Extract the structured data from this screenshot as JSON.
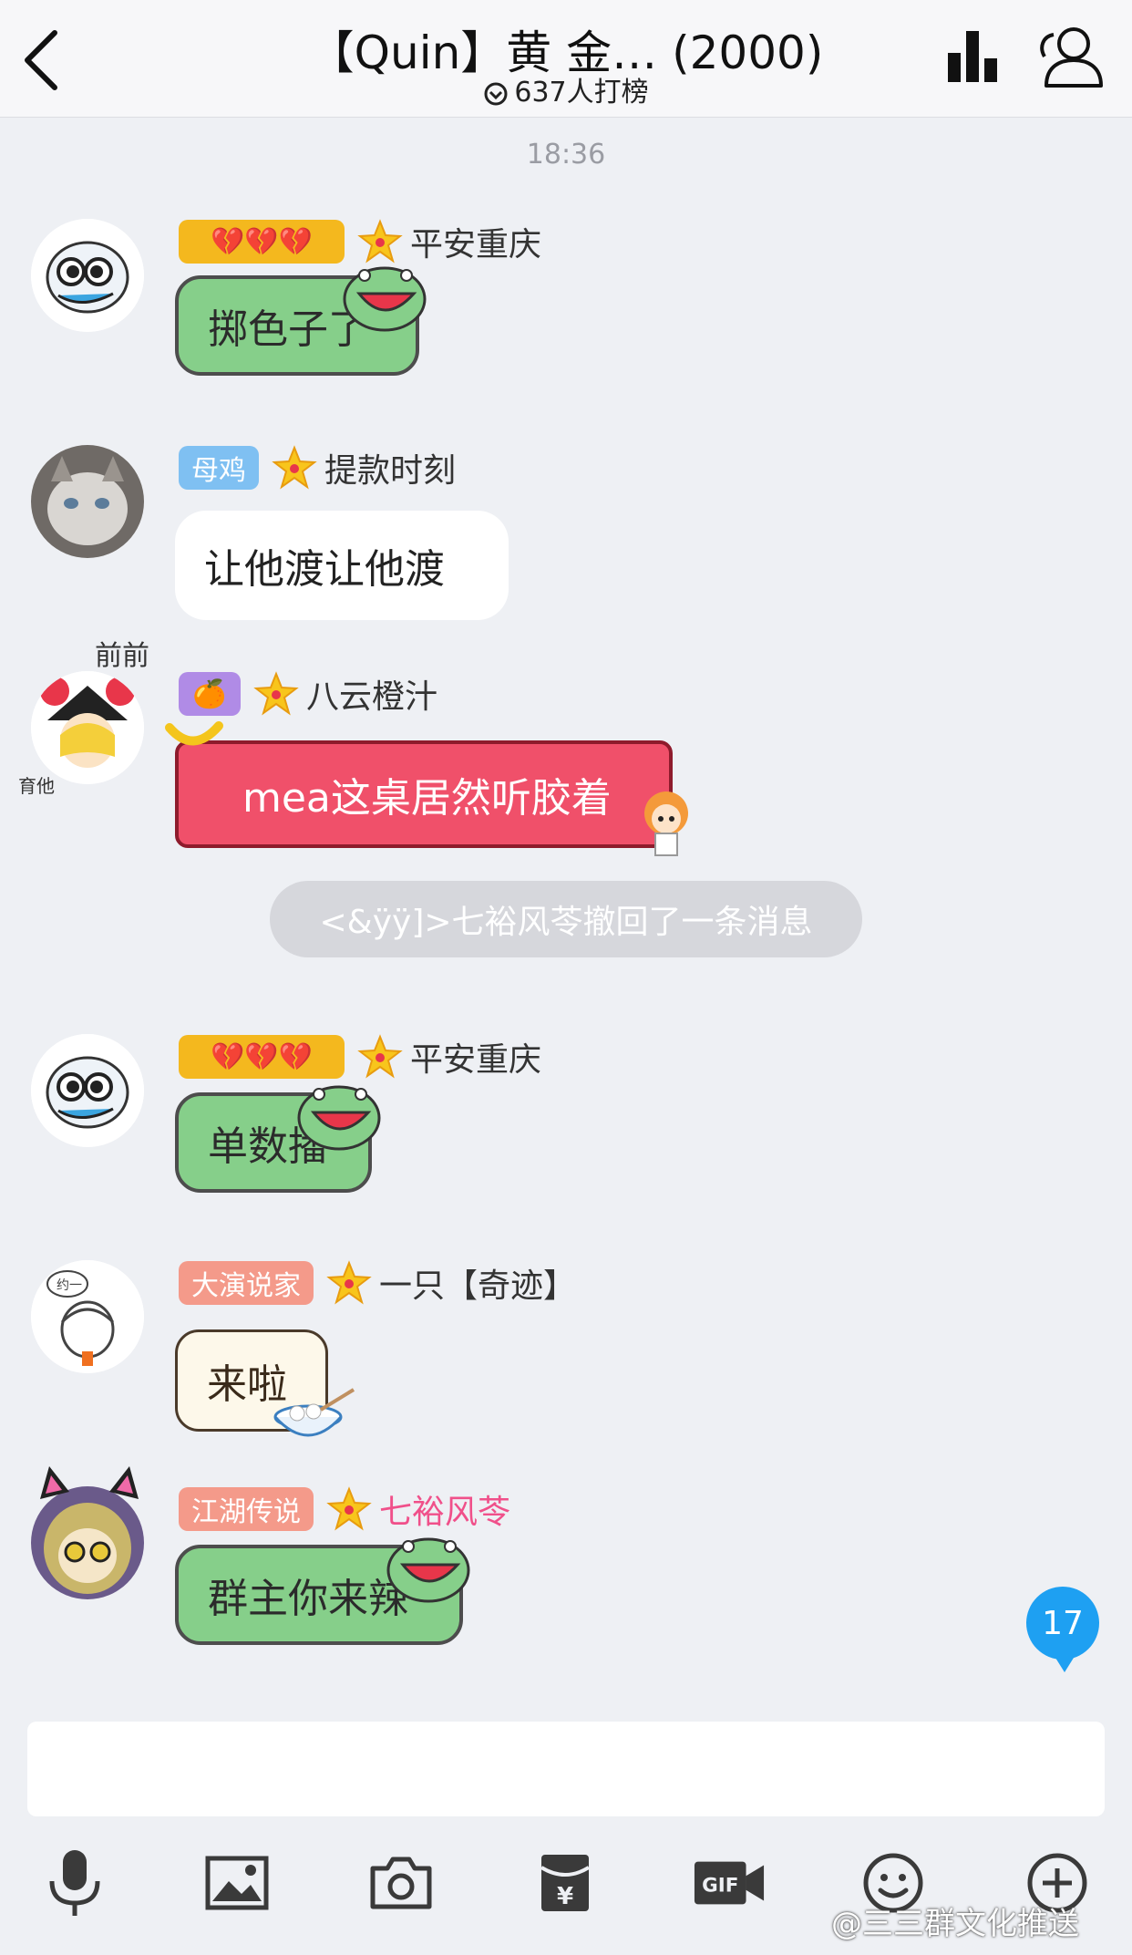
{
  "header": {
    "title": "【Quin】黄 金… (2000)",
    "subtitle": "637人打榜"
  },
  "timestamp": "18:36",
  "messages": [
    {
      "badge": "💔💔💔",
      "sender": "平安重庆",
      "text": "掷色子了"
    },
    {
      "badge": "母鸡",
      "sender": "提款时刻",
      "text": "让他渡让他渡"
    },
    {
      "badge": "🍊",
      "sender": "八云橙汁",
      "text": "mea这桌居然听胶着",
      "avatar_caption_top": "前前",
      "avatar_caption_side": "育他"
    },
    {
      "badge": "💔💔💔",
      "sender": "平安重庆",
      "text": "单数播"
    },
    {
      "badge": "大演说家",
      "sender": "一只【奇迹】",
      "text": "来啦",
      "avatar_caption": "约一"
    },
    {
      "badge": "江湖传说",
      "sender": "七裕风苓",
      "text": "群主你来辣"
    }
  ],
  "system_notice": "<&ÿÿ]>七裕风苓撤回了一条消息",
  "unread_count": "17",
  "toolbar": {
    "icons": [
      "microphone-icon",
      "image-icon",
      "camera-icon",
      "red-packet-icon",
      "gif-icon",
      "emoji-icon",
      "plus-icon"
    ],
    "gif_label": "GIF",
    "yen_label": "¥"
  },
  "watermark": "@三三群文化推送",
  "colors": {
    "green_bubble": "#86cf8a",
    "red_bubble": "#f0506a",
    "badge_gold": "#f4b81e",
    "badge_blue": "#7fc0f2",
    "badge_purple": "#b08be6",
    "badge_salmon": "#f49a8a",
    "pink_name": "#f0508a",
    "unread_blue": "#1ea0f2"
  }
}
